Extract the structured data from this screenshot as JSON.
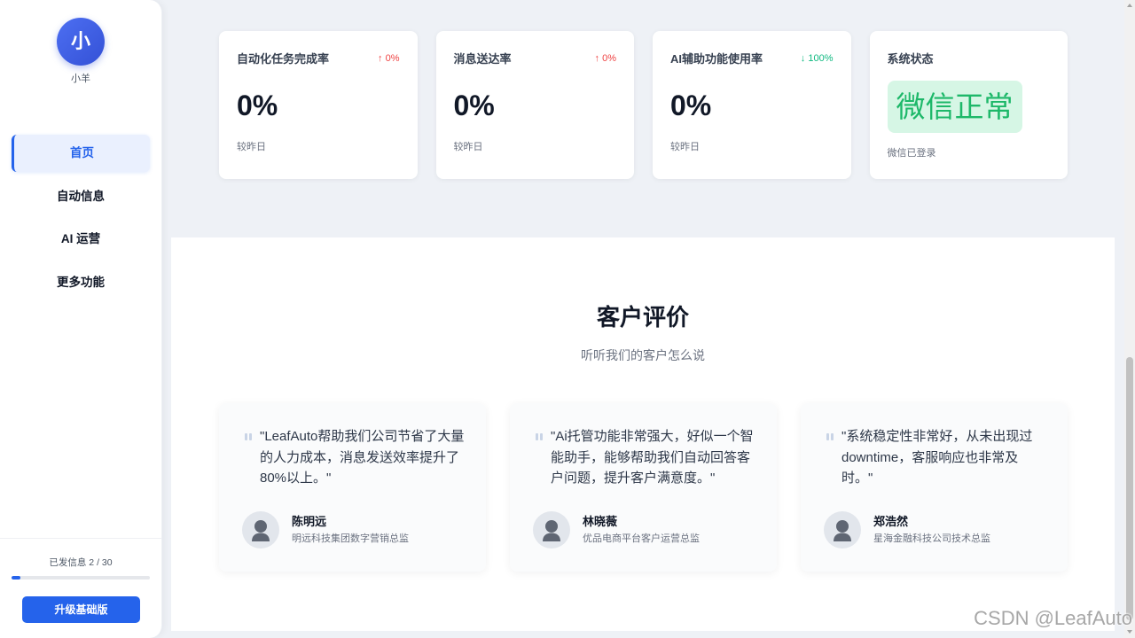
{
  "sidebar": {
    "avatar_initial": "小",
    "username": "小羊",
    "nav": [
      {
        "label": "首页",
        "active": true
      },
      {
        "label": "自动信息",
        "active": false
      },
      {
        "label": "AI 运营",
        "active": false
      },
      {
        "label": "更多功能",
        "active": false
      }
    ],
    "usage": {
      "text": "已发信息 2 / 30",
      "sent": 2,
      "limit": 30
    },
    "upgrade_label": "升级基础版"
  },
  "stats": [
    {
      "title": "自动化任务完成率",
      "change": "↑ 0%",
      "change_color": "#ef4444",
      "value": "0%",
      "caption": "较昨日"
    },
    {
      "title": "消息送达率",
      "change": "↑ 0%",
      "change_color": "#ef4444",
      "value": "0%",
      "caption": "较昨日"
    },
    {
      "title": "AI辅助功能使用率",
      "change": "↓ 100%",
      "change_color": "#10b981",
      "value": "0%",
      "caption": "较昨日"
    }
  ],
  "system_status": {
    "title": "系统状态",
    "badge": "微信正常",
    "badge_color": "#1db869",
    "badge_bg": "#d6f6e5",
    "caption": "微信已登录"
  },
  "testimonials": {
    "heading": "客户评价",
    "subheading": "听听我们的客户怎么说",
    "quote_icon": "quote-icon",
    "avatar_icon": "user-icon",
    "items": [
      {
        "quote": "\"LeafAuto帮助我们公司节省了大量的人力成本，消息发送效率提升了80%以上。\"",
        "name": "陈明远",
        "role": "明远科技集团数字营销总监"
      },
      {
        "quote": "\"Ai托管功能非常强大，好似一个智能助手，能够帮助我们自动回答客户问题，提升客户满意度。\"",
        "name": "林晓薇",
        "role": "优品电商平台客户运营总监"
      },
      {
        "quote": "\"系统稳定性非常好，从未出现过downtime，客服响应也非常及时。\"",
        "name": "郑浩然",
        "role": "星海金融科技公司技术总监"
      }
    ]
  },
  "colors": {
    "primary": "#2563eb",
    "page_bg": "#eef1f6"
  },
  "watermark": "CSDN @LeafAuto"
}
